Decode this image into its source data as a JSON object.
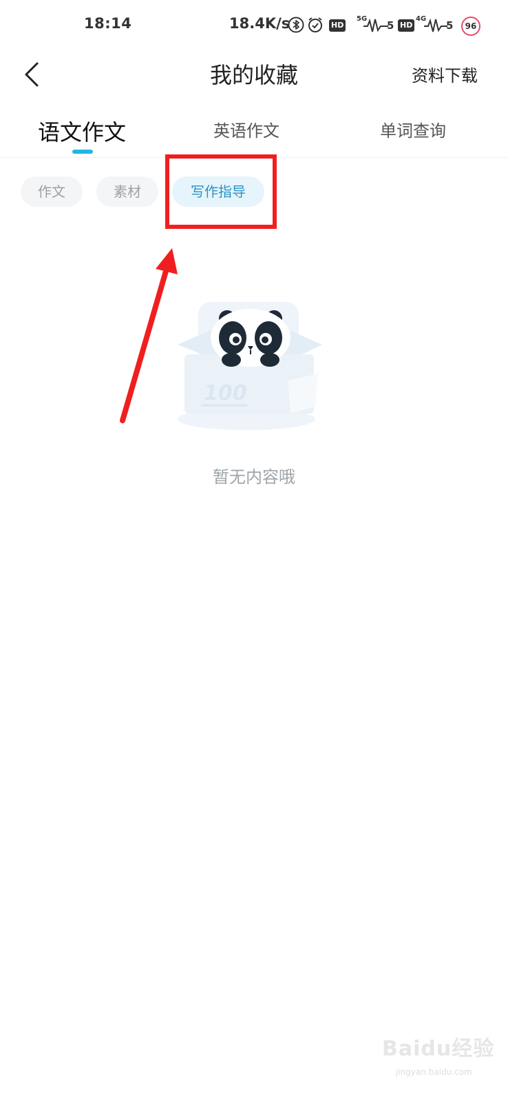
{
  "status_bar": {
    "time": "18:14",
    "net_speed": "18.4K/s",
    "hd1": "HD",
    "hd2": "HD",
    "sig1_label": "5G",
    "sig1_num": "5",
    "sig2_label": "4G",
    "sig2_num": "5",
    "battery": "96",
    "icons": [
      "bluetooth-icon",
      "alarm-icon"
    ]
  },
  "header": {
    "title": "我的收藏",
    "right_action": "资料下载"
  },
  "tabs": [
    {
      "label": "语文作文",
      "active": true
    },
    {
      "label": "英语作文",
      "active": false
    },
    {
      "label": "单词查询",
      "active": false
    }
  ],
  "chips": [
    {
      "label": "作文",
      "active": false
    },
    {
      "label": "素材",
      "active": false
    },
    {
      "label": "写作指导",
      "active": true
    }
  ],
  "empty_state": {
    "message": "暂无内容哦",
    "box_text": "100"
  },
  "watermark": {
    "main": "Baidu经验",
    "sub": "jingyan.baidu.com"
  },
  "colors": {
    "accent": "#21b6e6",
    "chip_active_text": "#2a92c6",
    "annotation": "#f01f1f"
  }
}
